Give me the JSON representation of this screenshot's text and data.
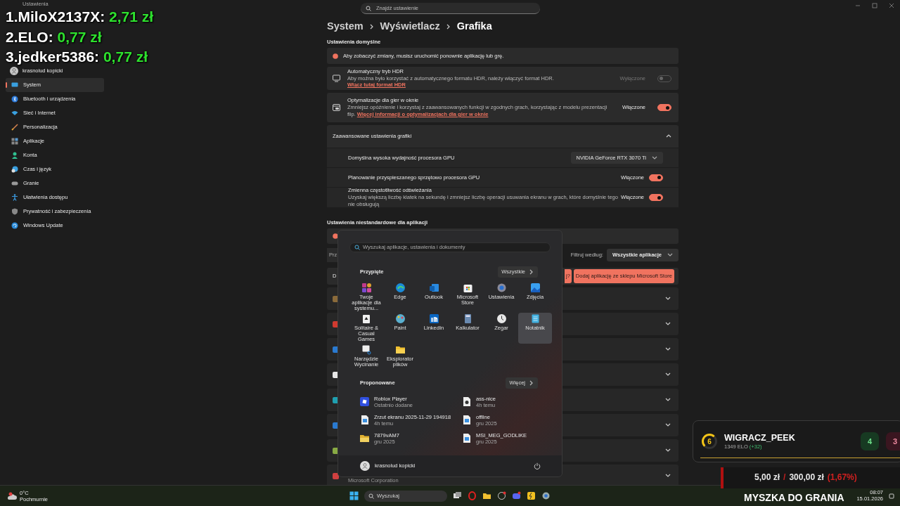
{
  "window": {
    "title": "Ustawienia"
  },
  "account": {
    "name": "krasnolud kopicki"
  },
  "search": {
    "placeholder": "Znajdź ustawienie"
  },
  "sidebar": {
    "items": [
      {
        "label": "System",
        "selected": true
      },
      {
        "label": "Bluetooth i urządzenia",
        "selected": false
      },
      {
        "label": "Sieć i Internet",
        "selected": false
      },
      {
        "label": "Personalizacja",
        "selected": false
      },
      {
        "label": "Aplikacje",
        "selected": false
      },
      {
        "label": "Konta",
        "selected": false
      },
      {
        "label": "Czas i język",
        "selected": false
      },
      {
        "label": "Granie",
        "selected": false
      },
      {
        "label": "Ułatwienia dostępu",
        "selected": false
      },
      {
        "label": "Prywatność i zabezpieczenia",
        "selected": false
      },
      {
        "label": "Windows Update",
        "selected": false
      }
    ]
  },
  "breadcrumb": [
    "System",
    "Wyświetlacz",
    "Grafika"
  ],
  "default_settings": {
    "heading": "Ustawienia domyślne",
    "notice": "Aby zobaczyć zmiany, musisz uruchomić ponownie aplikację lub grę.",
    "items": [
      {
        "title": "Automatyczny tryb HDR",
        "description": "Aby można było korzystać z automatycznego formatu HDR, należy włączyć format HDR.",
        "link": "Włącz tutaj format HDR",
        "state_label": "Wyłączone",
        "on": false,
        "disabled": true
      },
      {
        "title": "Optymalizacje dla gier w oknie",
        "description": "Zmniejsz opóźnienie i korzystaj z zaawansowanych funkcji w zgodnych grach, korzystając z modelu prezentacji flip.",
        "link": "Więcej informacji o optymalizacjach dla gier w oknie",
        "state_label": "Włączone",
        "on": true,
        "disabled": false
      }
    ]
  },
  "advanced": {
    "title": "Zaawansowane ustawienia grafiki",
    "expanded": true,
    "items": [
      {
        "kind": "dropdown",
        "title": "Domyślna wysoka wydajność procesora GPU",
        "value": "NVIDIA GeForce RTX 3070 Ti"
      },
      {
        "kind": "toggle",
        "title": "Planowanie przyspieszanego sprzętowo procesora GPU",
        "state_label": "Włączone",
        "on": true
      },
      {
        "kind": "toggle",
        "title": "Zmienna częstotliwość odświeżania",
        "description": "Uzyskaj większą liczbę klatek na sekundę i zmniejsz liczbę operacji usuwania ekranu w grach, które domyślnie tego nie obsługują",
        "state_label": "Włączone",
        "on": true
      }
    ]
  },
  "custom_apps": {
    "heading": "Ustawienia niestandardowe dla aplikacji",
    "tab_partial": "Prz",
    "row_partial": "D",
    "filter_label": "Filtruj według:",
    "filter_value": "Wszystkie aplikacje",
    "partial_button": "j?",
    "add_button": "Dodaj aplikację ze sklepu Microsoft Store",
    "app_rows": [
      {
        "color": "#8a6a3a",
        "expanded": false
      },
      {
        "color": "#d03a30",
        "expanded": false
      },
      {
        "color": "#2a7ad0",
        "expanded": false
      },
      {
        "color": "#e8e8e8",
        "expanded": false
      },
      {
        "color": "#1fa0b0",
        "expanded": false
      },
      {
        "color": "#2a7ad0",
        "expanded": false
      },
      {
        "color": "#88aa44",
        "expanded": false
      },
      {
        "color": "#d04040",
        "expanded": false,
        "publisher": "Microsoft Corporation"
      }
    ]
  },
  "start_menu": {
    "search_placeholder": "Wyszukaj aplikacje, ustawienia i dokumenty",
    "pinned_heading": "Przypięte",
    "all_button": "Wszystkie",
    "pinned": [
      {
        "label": "Twoje aplikacje dla systemu...",
        "highlighted": false
      },
      {
        "label": "Edge",
        "highlighted": false
      },
      {
        "label": "Outlook",
        "highlighted": false
      },
      {
        "label": "Microsoft Store",
        "highlighted": false
      },
      {
        "label": "Ustawienia",
        "highlighted": false
      },
      {
        "label": "Zdjęcia",
        "highlighted": false
      },
      {
        "label": "Solitaire & Casual Games",
        "highlighted": false
      },
      {
        "label": "Paint",
        "highlighted": false
      },
      {
        "label": "LinkedIn",
        "highlighted": false
      },
      {
        "label": "Kalkulator",
        "highlighted": false
      },
      {
        "label": "Zegar",
        "highlighted": false
      },
      {
        "label": "Notatnik",
        "highlighted": true
      },
      {
        "label": "Narzędzie Wycinanie",
        "highlighted": false
      },
      {
        "label": "Eksplorator plików",
        "highlighted": false
      }
    ],
    "recommended_heading": "Proponowane",
    "more_button": "Więcej",
    "recommended": [
      {
        "title": "Roblox Player",
        "subtitle": "Ostatnio dodane"
      },
      {
        "title": "ass-nice",
        "subtitle": "4h temu"
      },
      {
        "title": "Zrzut ekranu 2025-11-29 194918",
        "subtitle": "4h temu"
      },
      {
        "title": "offline",
        "subtitle": "gru 2025"
      },
      {
        "title": "7879vAM7",
        "subtitle": "gru 2025"
      },
      {
        "title": "MSI_MEG_GODLIKE",
        "subtitle": "gru 2025"
      }
    ],
    "user": "krasnolud kopicki"
  },
  "taskbar": {
    "temperature": "0°C",
    "weather": "Pochmurnie",
    "search_placeholder": "Wyszukaj",
    "time": "08:07",
    "date": "15.01.2026"
  },
  "stream_overlay": {
    "leaderboard": [
      {
        "name": "1.MiloX2137X:",
        "amount": "2,71 zł"
      },
      {
        "name": "2.ELO:",
        "amount": "0,77 zł"
      },
      {
        "name": "3.jedker5386:",
        "amount": "0,77 zł"
      }
    ],
    "player": {
      "level": "6",
      "name": "WIGRACZ_PEEK",
      "elo": "1349 ELO",
      "elo_change": "(+32)",
      "wins": "4",
      "losses": "3"
    },
    "goal": {
      "raised": "5,00 zł",
      "separator": "/",
      "target": "300,00 zł",
      "percent": "(1,67%)",
      "level": 0.0167
    },
    "banner": "MYSZKA DO GRANIA"
  }
}
